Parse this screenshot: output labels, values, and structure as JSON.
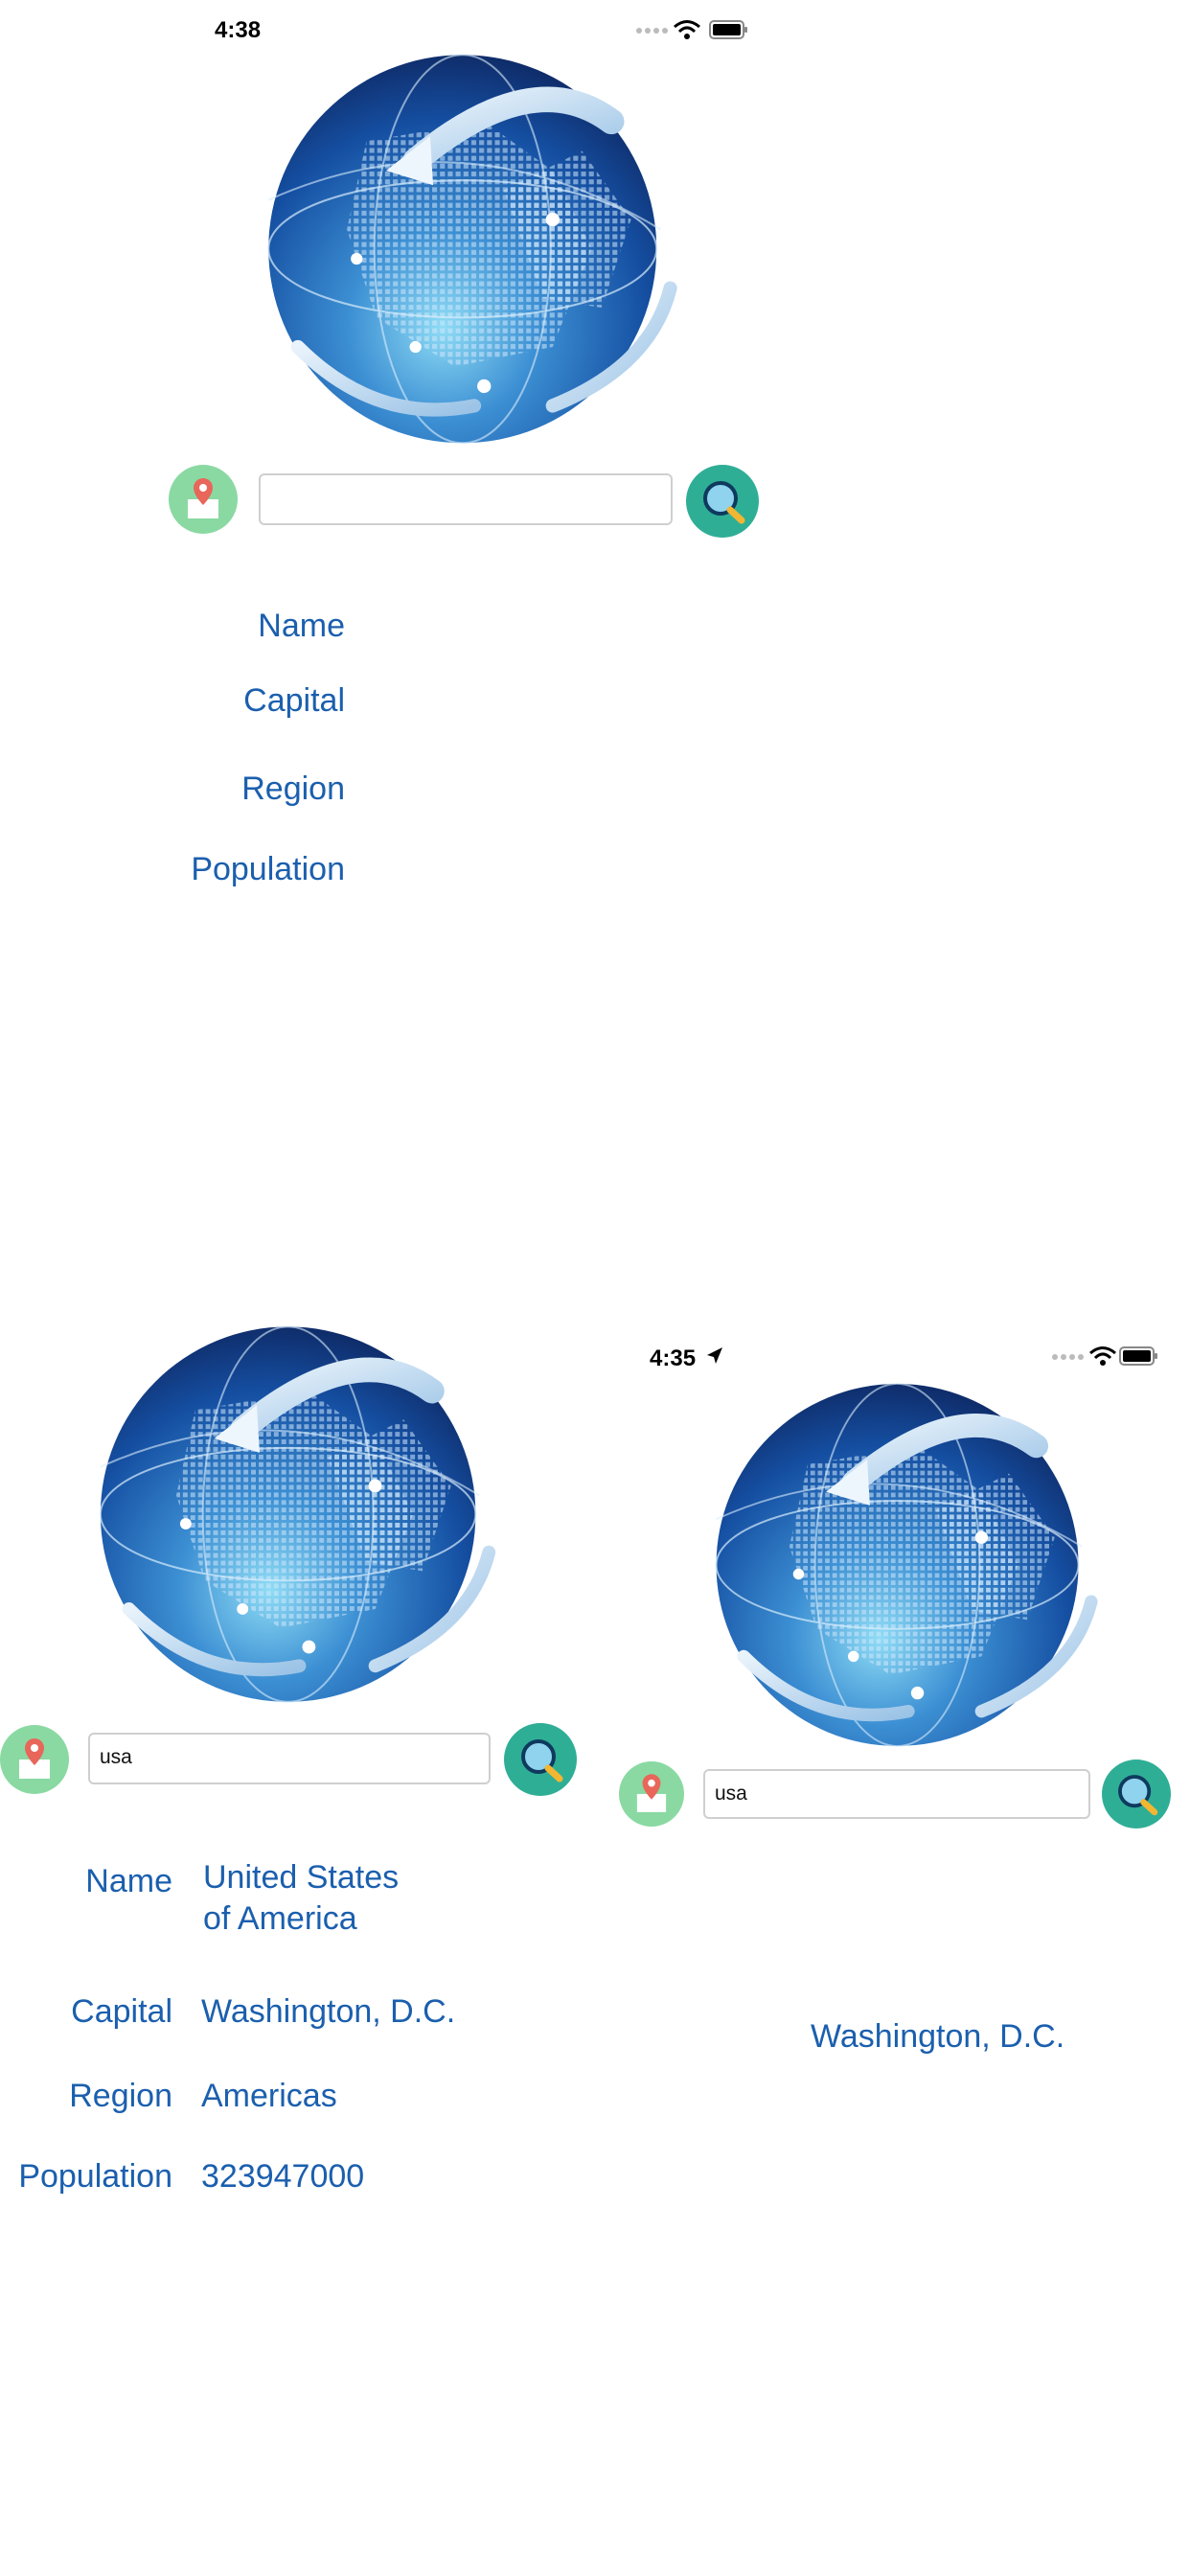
{
  "screen1": {
    "status": {
      "time": "4:38"
    },
    "search": {
      "value": ""
    },
    "labels": {
      "name": "Name",
      "capital": "Capital",
      "region": "Region",
      "population": "Population"
    }
  },
  "screen2": {
    "search": {
      "value": "usa"
    },
    "labels": {
      "name": "Name",
      "capital": "Capital",
      "region": "Region",
      "population": "Population"
    },
    "values": {
      "name_line1": "United States",
      "name_line2": "of America",
      "capital": "Washington, D.C.",
      "region": "Americas",
      "population": "323947000"
    }
  },
  "screen3": {
    "status": {
      "time": "4:35"
    },
    "search": {
      "value": "usa"
    },
    "values": {
      "capital": "Washington, D.C."
    }
  },
  "icons": {
    "location": "map-pin-icon",
    "search": "magnifier-icon",
    "globe": "globe-illustration",
    "wifi": "wifi-icon",
    "battery": "battery-icon",
    "signal": "signal-dots-icon",
    "location_arrow": "location-arrow-icon"
  },
  "colors": {
    "label_blue": "#1b5fae",
    "search_button": "#2fae96",
    "location_button": "#8ad9a2",
    "globe_dark": "#0f2d6b",
    "globe_light": "#5fc3ec"
  }
}
